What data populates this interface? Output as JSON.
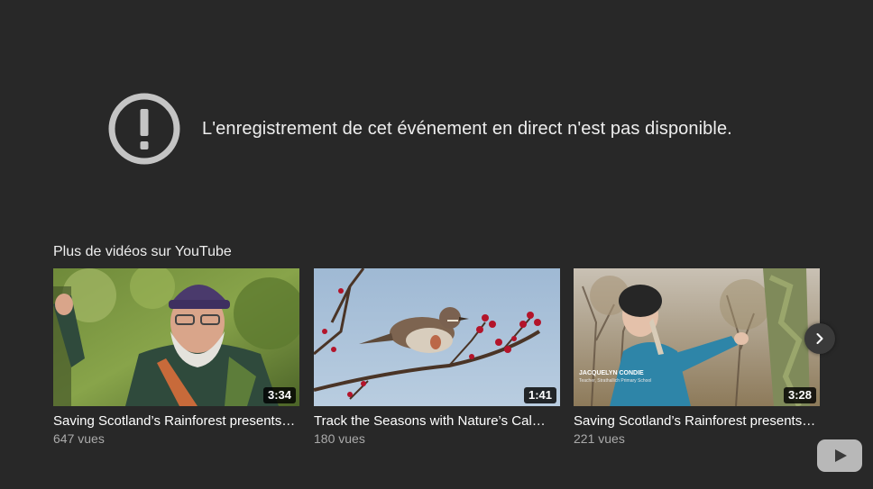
{
  "error": {
    "message": "L'enregistrement de cet événement en direct n'est pas disponible.",
    "icon": "exclamation-circle-icon"
  },
  "more_videos": {
    "title": "Plus de vidéos sur YouTube",
    "videos": [
      {
        "title": "Saving Scotland’s Rainforest presents…",
        "views": "647 vues",
        "duration": "3:34"
      },
      {
        "title": "Track the Seasons with Nature’s Cal…",
        "views": "180 vues",
        "duration": "1:41"
      },
      {
        "title": "Saving Scotland’s Rainforest presents…",
        "views": "221 vues",
        "duration": "3:28",
        "caption_name": "JACQUELYN CONDIE",
        "caption_role": "Teacher, Strathallich Primary School"
      }
    ],
    "next_icon": "chevron-right-icon"
  },
  "youtube_logo_icon": "youtube-logo-icon",
  "colors": {
    "background": "#282828",
    "text": "#eeeeee",
    "secondary_text": "#aaaaaa",
    "icon_gray": "#c4c4c4"
  }
}
